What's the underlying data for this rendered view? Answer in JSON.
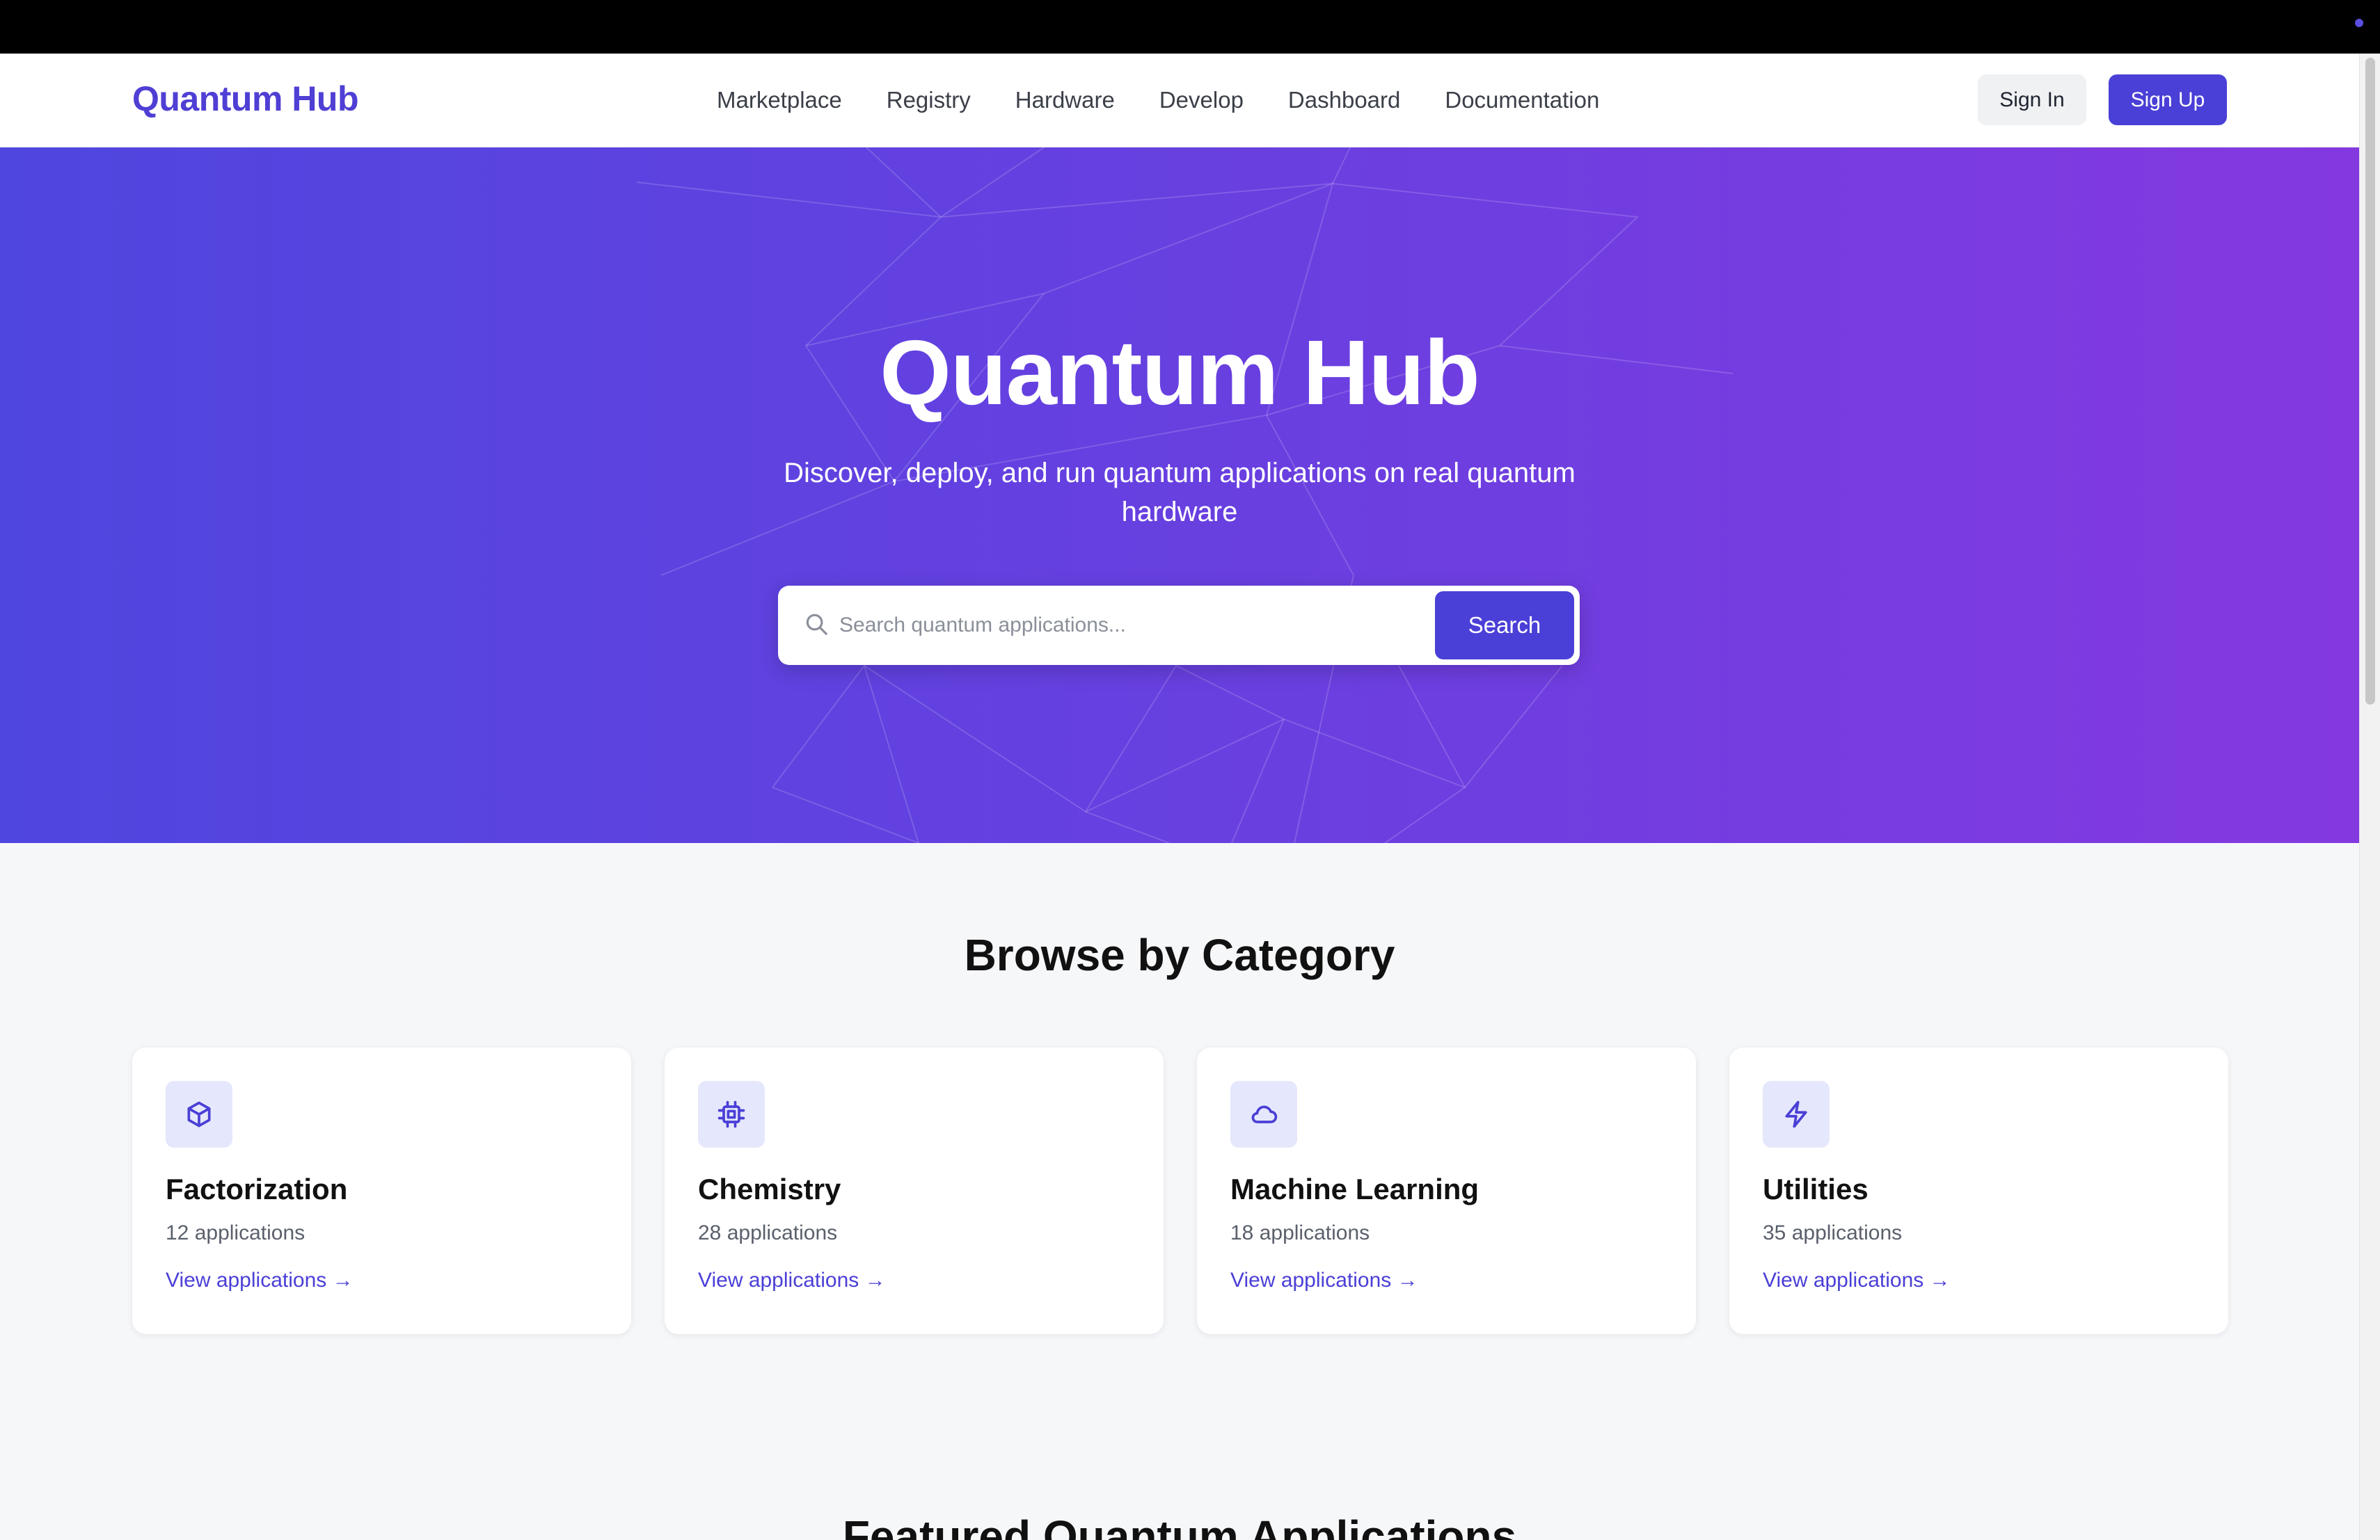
{
  "nav": {
    "logo": "Quantum Hub",
    "links": [
      "Marketplace",
      "Registry",
      "Hardware",
      "Develop",
      "Dashboard",
      "Documentation"
    ],
    "signin_label": "Sign In",
    "signup_label": "Sign Up"
  },
  "hero": {
    "title": "Quantum Hub",
    "subtitle": "Discover, deploy, and run quantum applications on real quantum hardware",
    "search_placeholder": "Search quantum applications...",
    "search_button": "Search"
  },
  "categories": {
    "title": "Browse by Category",
    "items": [
      {
        "name": "Factorization",
        "count": "12 applications",
        "link": "View applications →",
        "icon": "cube-icon"
      },
      {
        "name": "Chemistry",
        "count": "28 applications",
        "link": "View applications →",
        "icon": "chip-icon"
      },
      {
        "name": "Machine Learning",
        "count": "18 applications",
        "link": "View applications →",
        "icon": "cloud-icon"
      },
      {
        "name": "Utilities",
        "count": "35 applications",
        "link": "View applications →",
        "icon": "lightning-icon"
      }
    ]
  },
  "featured": {
    "title": "Featured Quantum Applications"
  },
  "colors": {
    "accent": "#4a3fd6",
    "hero_start": "#4f46df",
    "hero_end": "#8439e0",
    "icon_bg": "#e5e8fc"
  }
}
